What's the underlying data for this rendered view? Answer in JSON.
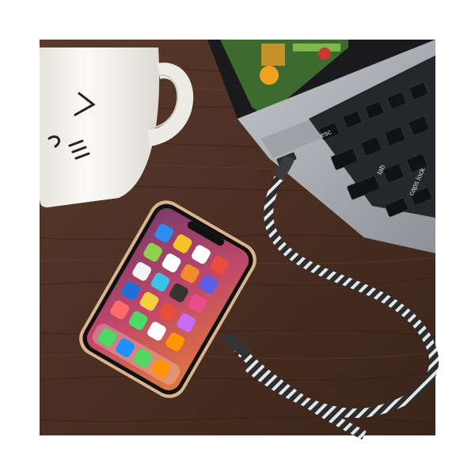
{
  "photo": {
    "background_color": "#ffffff",
    "table_color": "#4a2e22",
    "table_grain_color": "#2e1a12",
    "mug_color": "#f4f2ee",
    "laptop_body_color": "#a9acb0",
    "keyboard_color": "#1b1c1e",
    "phone_frame_color": "#d9b48f",
    "cable_color": "#2c2d2f",
    "cable_stripe_color": "#e6e6e6"
  },
  "keyboard": {
    "keys": [
      "esc",
      "tab",
      "caps lock"
    ]
  },
  "mug": {
    "face_icon": "sleepy-cat-face-icon"
  },
  "phone": {
    "screen_icons": [
      "app-grid-icons"
    ]
  }
}
